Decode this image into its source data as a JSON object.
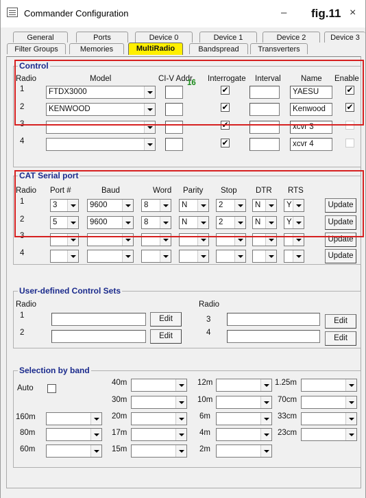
{
  "window": {
    "title": "Commander Configuration",
    "fig_label": "fig.11",
    "minimize": "–",
    "close": "×"
  },
  "icons": {
    "app": "app-config-icon",
    "dropdown": "chevron-down-icon"
  },
  "colors": {
    "active_tab": "#ffef00",
    "group_title": "#1a2a8c",
    "highlight": "#d62020",
    "civ_value": "#1a8a1a"
  },
  "tabs": {
    "row1": [
      "General",
      "Ports",
      "Device 0",
      "Device 1",
      "Device 2",
      "Device 3"
    ],
    "row2": [
      "Filter Groups",
      "Memories",
      "MultiRadio",
      "Bandspread",
      "Transverters"
    ],
    "active": "MultiRadio"
  },
  "control": {
    "title": "Control",
    "headers": {
      "radio": "Radio",
      "model": "Model",
      "civ": "CI-V Addr",
      "interrogate": "Interrogate",
      "interval": "Interval",
      "name": "Name",
      "enable": "Enable"
    },
    "civ_value": "16",
    "rows": [
      {
        "radio": "1",
        "model": "FTDX3000",
        "civ": "",
        "interrogate": "✔",
        "interval": "",
        "name": "YAESU",
        "enable": "✔"
      },
      {
        "radio": "2",
        "model": "KENWOOD",
        "civ": "",
        "interrogate": "✔",
        "interval": "",
        "name": "Kenwood",
        "enable": "✔"
      },
      {
        "radio": "3",
        "model": "",
        "civ": "",
        "interrogate": "✔",
        "interval": "",
        "name": "xcvr 3",
        "enable": ""
      },
      {
        "radio": "4",
        "model": "",
        "civ": "",
        "interrogate": "✔",
        "interval": "",
        "name": "xcvr 4",
        "enable": ""
      }
    ]
  },
  "cat": {
    "title": "CAT Serial port",
    "headers": {
      "radio": "Radio",
      "port": "Port #",
      "baud": "Baud",
      "word": "Word",
      "parity": "Parity",
      "stop": "Stop",
      "dtr": "DTR",
      "rts": "RTS"
    },
    "update_label": "Update",
    "rows": [
      {
        "radio": "1",
        "port": "3",
        "baud": "9600",
        "word": "8",
        "parity": "N",
        "stop": "2",
        "dtr": "N",
        "rts": "Y"
      },
      {
        "radio": "2",
        "port": "5",
        "baud": "9600",
        "word": "8",
        "parity": "N",
        "stop": "2",
        "dtr": "N",
        "rts": "Y"
      },
      {
        "radio": "3",
        "port": "",
        "baud": "",
        "word": "",
        "parity": "",
        "stop": "",
        "dtr": "",
        "rts": ""
      },
      {
        "radio": "4",
        "port": "",
        "baud": "",
        "word": "",
        "parity": "",
        "stop": "",
        "dtr": "",
        "rts": ""
      }
    ]
  },
  "user": {
    "title": "User-defined Control Sets",
    "radio_label": "Radio",
    "edit_label": "Edit",
    "rows": [
      {
        "radio": "1",
        "value": ""
      },
      {
        "radio": "2",
        "value": ""
      },
      {
        "radio": "3",
        "value": ""
      },
      {
        "radio": "4",
        "value": ""
      }
    ]
  },
  "bands": {
    "title": "Selection by band",
    "auto_label": "Auto",
    "col1": [
      "160m",
      "80m",
      "60m"
    ],
    "col2": [
      "40m",
      "30m",
      "20m",
      "17m",
      "15m"
    ],
    "col3": [
      "12m",
      "10m",
      "6m",
      "4m",
      "2m"
    ],
    "col4": [
      "1.25m",
      "70cm",
      "33cm",
      "23cm"
    ]
  }
}
